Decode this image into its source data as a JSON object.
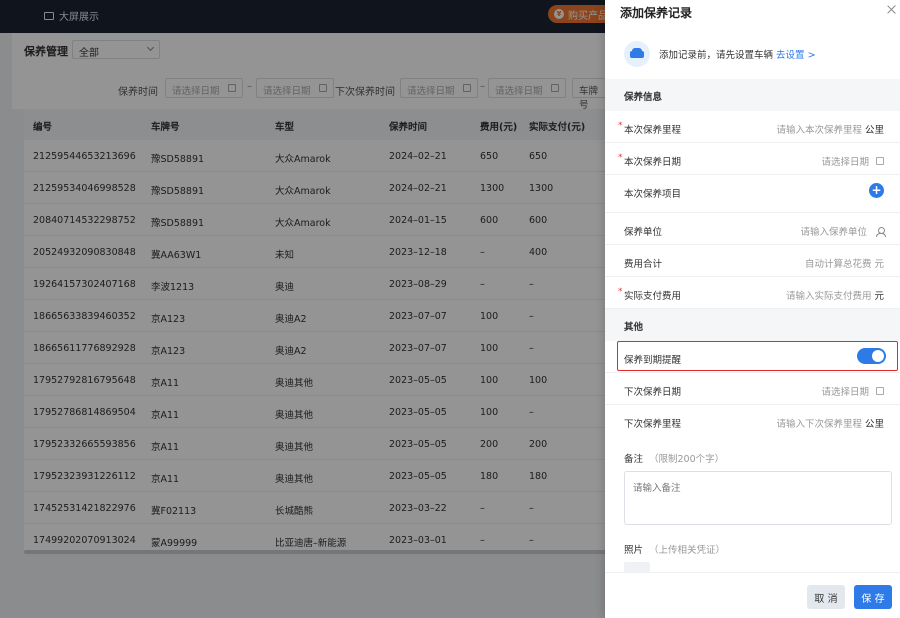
{
  "topbar": {
    "screen_link": "大屏展示",
    "buy_label": "购买产品"
  },
  "filter": {
    "title": "保养管理",
    "scope_value": "全部"
  },
  "search": {
    "maint_time_label": "保养时间",
    "next_time_label": "下次保养时间",
    "plate_label": "车牌号",
    "date_placeholder": "请选择日期",
    "dash": "–"
  },
  "table": {
    "columns": [
      "编号",
      "车牌号",
      "车型",
      "保养时间",
      "费用(元)",
      "实际支付(元)"
    ],
    "rows": [
      [
        "21259544653213696",
        "豫SD58891",
        "大众Amarok",
        "2024–02–21",
        "650",
        "650"
      ],
      [
        "21259534046998528",
        "豫SD58891",
        "大众Amarok",
        "2024–02–21",
        "1300",
        "1300"
      ],
      [
        "20840714532298752",
        "豫SD58891",
        "大众Amarok",
        "2024–01–15",
        "600",
        "600"
      ],
      [
        "20524932090830848",
        "冀AA63W1",
        "未知",
        "2023–12–18",
        "–",
        "400"
      ],
      [
        "19264157302407168",
        "李波1213",
        "奥迪",
        "2023–08–29",
        "–",
        "–"
      ],
      [
        "18665633839460352",
        "京A123",
        "奥迪A2",
        "2023–07–07",
        "100",
        "–"
      ],
      [
        "18665611776892928",
        "京A123",
        "奥迪A2",
        "2023–07–07",
        "100",
        "–"
      ],
      [
        "17952792816795648",
        "京A11",
        "奥迪其他",
        "2023–05–05",
        "100",
        "100"
      ],
      [
        "17952786814869504",
        "京A11",
        "奥迪其他",
        "2023–05–05",
        "100",
        "–"
      ],
      [
        "17952332665593856",
        "京A11",
        "奥迪其他",
        "2023–05–05",
        "200",
        "200"
      ],
      [
        "17952323931226112",
        "京A11",
        "奥迪其他",
        "2023–05–05",
        "180",
        "180"
      ],
      [
        "17452531421822976",
        "冀F02113",
        "长城酷熊",
        "2023–03–22",
        "–",
        "–"
      ],
      [
        "17499202070913024",
        "蒙A99999",
        "比亚迪唐–新能源",
        "2023–03–01",
        "–",
        "–"
      ]
    ]
  },
  "drawer": {
    "title": "添加保养记录",
    "notice_text": "添加记录前，请先设置车辆",
    "notice_link": "去设置 >",
    "section_info": "保养信息",
    "section_other": "其他",
    "fields": {
      "mileage": {
        "label": "本次保养里程",
        "placeholder": "请输入本次保养里程",
        "unit": "公里"
      },
      "date": {
        "label": "本次保养日期",
        "placeholder": "请选择日期"
      },
      "items": {
        "label": "本次保养项目"
      },
      "unit_org": {
        "label": "保养单位",
        "placeholder": "请输入保养单位"
      },
      "total": {
        "label": "费用合计",
        "placeholder": "自动计算总花费",
        "unit": "元"
      },
      "paid": {
        "label": "实际支付费用",
        "placeholder": "请输入实际支付费用",
        "unit": "元"
      },
      "reminder": {
        "label": "保养到期提醒",
        "enabled": true
      },
      "next_date": {
        "label": "下次保养日期",
        "placeholder": "请选择日期"
      },
      "next_mileage": {
        "label": "下次保养里程",
        "placeholder": "请输入下次保养里程",
        "unit": "公里"
      }
    },
    "remark": {
      "label": "备注",
      "hint": "（限制200个字）",
      "placeholder": "请输入备注"
    },
    "photo": {
      "label": "照片",
      "hint": "（上传相关凭证）"
    },
    "cancel_label": "取 消",
    "save_label": "保 存"
  },
  "colors": {
    "primary": "#2e7be8",
    "required": "#e83a3a",
    "highlight": "#e02a2a",
    "topbar": "#1c2333",
    "buy": "#f07530"
  }
}
